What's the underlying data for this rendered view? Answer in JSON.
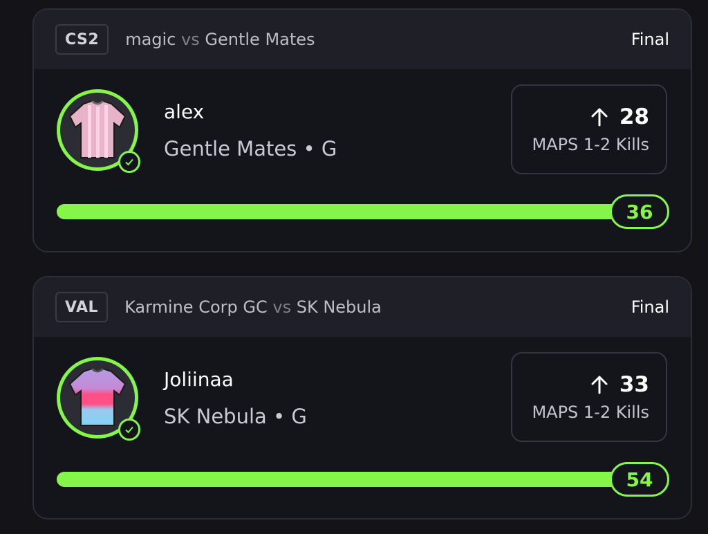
{
  "colors": {
    "accent": "#85f649",
    "background": "#131318",
    "card_header": "#1e1f27"
  },
  "cards": [
    {
      "league": "CS2",
      "team_a": "magic",
      "vs": "vs",
      "team_b": "Gentle Mates",
      "status": "Final",
      "player": "alex",
      "team_position": "Gentle Mates • G",
      "direction_icon": "arrow-up-icon",
      "line": "28",
      "stat_label": "MAPS 1-2 Kills",
      "result": "36",
      "progress": 1.0
    },
    {
      "league": "VAL",
      "team_a": "Karmine Corp GC",
      "vs": "vs",
      "team_b": "SK Nebula",
      "status": "Final",
      "player": "Joliinaa",
      "team_position": "SK Nebula • G",
      "direction_icon": "arrow-up-icon",
      "line": "33",
      "stat_label": "MAPS 1-2 Kills",
      "result": "54",
      "progress": 1.0
    }
  ]
}
